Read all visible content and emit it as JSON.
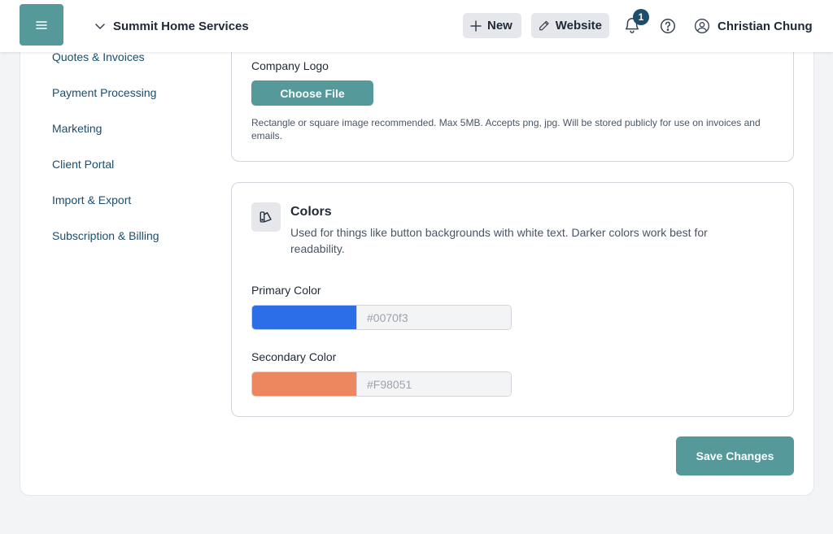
{
  "header": {
    "company_name": "Summit Home Services",
    "new_label": "New",
    "website_label": "Website",
    "notification_count": "1",
    "user_name": "Christian Chung"
  },
  "sidebar": {
    "items": [
      {
        "label": "Quotes & Invoices"
      },
      {
        "label": "Payment Processing"
      },
      {
        "label": "Marketing"
      },
      {
        "label": "Client Portal"
      },
      {
        "label": "Import & Export"
      },
      {
        "label": "Subscription & Billing"
      }
    ]
  },
  "logo_section": {
    "label": "Company Logo",
    "button_label": "Choose File",
    "help_text": "Rectangle or square image recommended. Max 5MB. Accepts png, jpg. Will be stored publicly for use on invoices and emails."
  },
  "colors_section": {
    "title": "Colors",
    "description": "Used for things like button backgrounds with white text. Darker colors work best for readability.",
    "primary": {
      "label": "Primary Color",
      "placeholder": "#0070f3",
      "swatch": "#2b6ee8"
    },
    "secondary": {
      "label": "Secondary Color",
      "placeholder": "#F98051",
      "swatch": "#ec8760"
    }
  },
  "actions": {
    "save_label": "Save Changes"
  },
  "theme": {
    "accent": "#55999a",
    "link": "#1d4d6b"
  }
}
